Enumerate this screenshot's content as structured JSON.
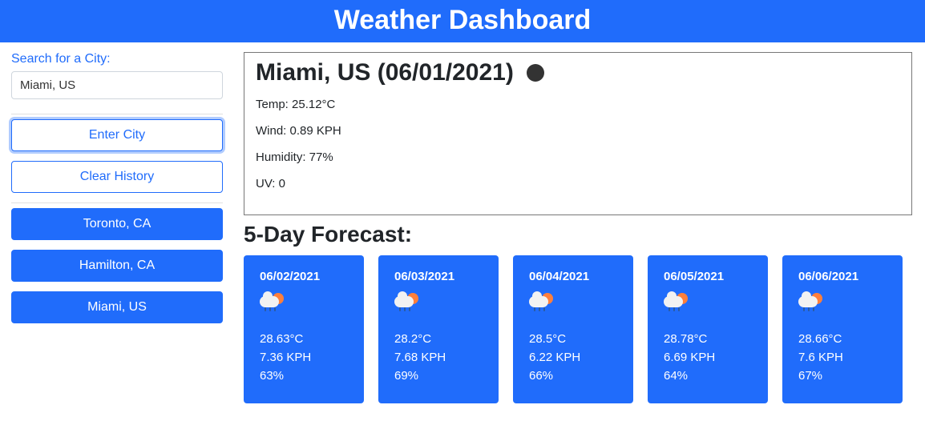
{
  "header": {
    "title": "Weather Dashboard"
  },
  "sidebar": {
    "search_label": "Search for a City:",
    "input_value": "Miami, US",
    "enter_button": "Enter City",
    "clear_button": "Clear History",
    "history": [
      "Toronto, CA",
      "Hamilton, CA",
      "Miami, US"
    ]
  },
  "current": {
    "title": "Miami, US (06/01/2021)",
    "temp": "Temp: 25.12°C",
    "wind": "Wind: 0.89 KPH",
    "humidity": "Humidity: 77%",
    "uv": "UV: 0"
  },
  "forecast": {
    "title": "5-Day Forecast:",
    "days": [
      {
        "date": "06/02/2021",
        "temp": "28.63°C",
        "wind": "7.36 KPH",
        "humidity": "63%"
      },
      {
        "date": "06/03/2021",
        "temp": "28.2°C",
        "wind": "7.68 KPH",
        "humidity": "69%"
      },
      {
        "date": "06/04/2021",
        "temp": "28.5°C",
        "wind": "6.22 KPH",
        "humidity": "66%"
      },
      {
        "date": "06/05/2021",
        "temp": "28.78°C",
        "wind": "6.69 KPH",
        "humidity": "64%"
      },
      {
        "date": "06/06/2021",
        "temp": "28.66°C",
        "wind": "7.6 KPH",
        "humidity": "67%"
      }
    ]
  }
}
